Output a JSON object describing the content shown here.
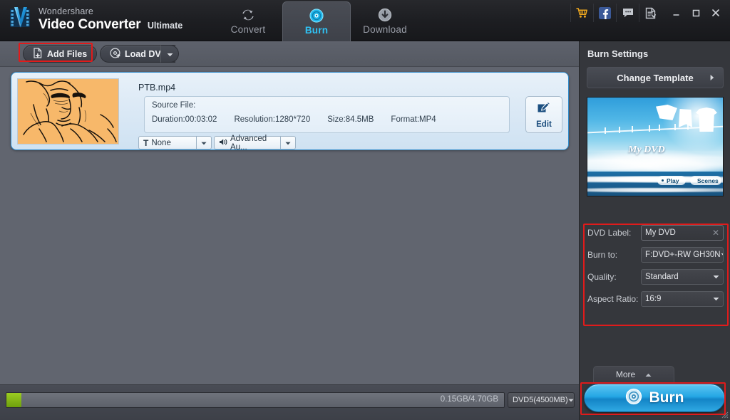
{
  "app": {
    "brand_top": "Wondershare",
    "brand_main": "Video Converter",
    "brand_edition": "Ultimate"
  },
  "titlebar": {
    "tabs": [
      {
        "label": "Convert",
        "icon": "convert-refresh-icon",
        "active": false
      },
      {
        "label": "Burn",
        "icon": "burn-disc-icon",
        "active": true
      },
      {
        "label": "Download",
        "icon": "download-arrow-icon",
        "active": false
      }
    ],
    "util_icons": [
      "cart-icon",
      "facebook-icon",
      "chat-icon",
      "register-icon"
    ],
    "window_buttons": [
      "minimize-button",
      "maximize-button",
      "close-button"
    ]
  },
  "toolbar": {
    "add_files_label": "Add Files",
    "load_dvd_label": "Load DVD"
  },
  "file_item": {
    "name": "PTB.mp4",
    "source_label": "Source File:",
    "duration": "Duration:00:03:02",
    "resolution": "Resolution:1280*720",
    "size": "Size:84.5MB",
    "format": "Format:MP4",
    "edit_label": "Edit",
    "subtitle_value": "None",
    "audio_value": "Advanced Au..."
  },
  "bottombar": {
    "capacity_text": "0.15GB/4.70GB",
    "disc_type": "DVD5(4500MB)",
    "progress_percent": 3
  },
  "sidebar": {
    "title": "Burn Settings",
    "change_template_label": "Change Template",
    "preview": {
      "menu_title": "My DVD",
      "play_label": "Play",
      "scenes_label": "Scenes"
    },
    "settings": [
      {
        "label": "DVD Label:",
        "value": "My DVD",
        "type": "text"
      },
      {
        "label": "Burn to:",
        "value": "F:DVD+-RW GH30N",
        "type": "select"
      },
      {
        "label": "Quality:",
        "value": "Standard",
        "type": "select"
      },
      {
        "label": "Aspect Ratio:",
        "value": "16:9",
        "type": "select"
      }
    ],
    "more_label": "More",
    "burn_label": "Burn"
  },
  "colors": {
    "accent_cyan": "#2fc3f5",
    "highlight_red": "#e01b1b",
    "progress_green": "#8ec41c",
    "sidebar_bg": "#35373c",
    "content_bg": "#61656f"
  }
}
